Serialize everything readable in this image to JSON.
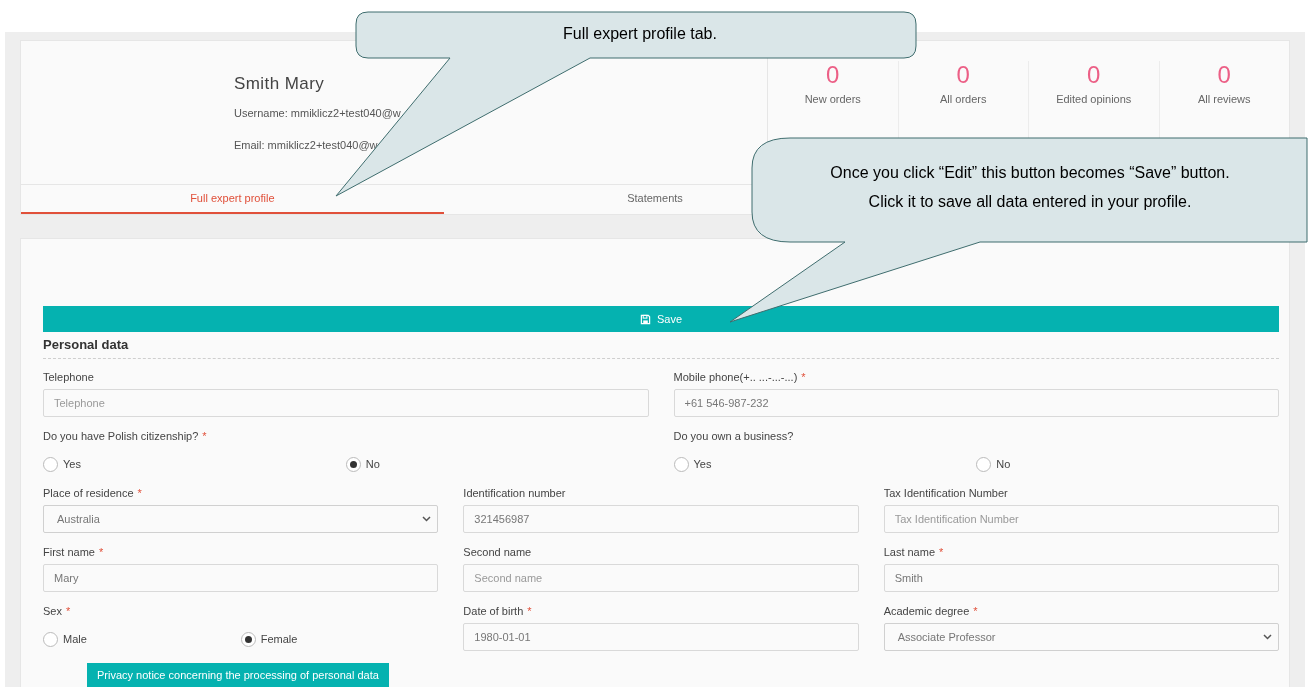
{
  "profile": {
    "name": "Smith Mary",
    "username": "Username: mmiklicz2+test040@w",
    "email": "Email: mmiklicz2+test040@w"
  },
  "stats": [
    {
      "value": "0",
      "label": "New orders"
    },
    {
      "value": "0",
      "label": "All orders"
    },
    {
      "value": "0",
      "label": "Edited opinions"
    },
    {
      "value": "0",
      "label": "All reviews"
    }
  ],
  "tabs": [
    {
      "label": "Full expert profile",
      "selected": true
    },
    {
      "label": "Statements",
      "selected": false
    }
  ],
  "form": {
    "save_button": "Save",
    "section_title": "Personal data",
    "rows": [
      [
        {
          "kind": "text",
          "label": "Telephone",
          "placeholder": "Telephone"
        },
        {
          "kind": "text",
          "label": "Mobile phone(+.. ...-...-...)",
          "required_mark": "*",
          "value": "+61 546-987-232"
        }
      ],
      [
        {
          "kind": "radio",
          "label": "Do you have Polish citizenship?",
          "required_mark": "*",
          "options": [
            {
              "label": "Yes",
              "selected": false
            },
            {
              "label": "No",
              "selected": true
            }
          ]
        },
        {
          "kind": "radio",
          "label": "Do you own a business?",
          "options": [
            {
              "label": "Yes",
              "selected": false
            },
            {
              "label": "No",
              "selected": false
            }
          ]
        }
      ],
      [
        {
          "kind": "select",
          "label": "Place of residence",
          "required_mark": "*",
          "value": "Australia"
        },
        {
          "kind": "text",
          "label": "Identification number",
          "value": "321456987"
        },
        {
          "kind": "text",
          "label": "Tax Identification Number",
          "placeholder": "Tax Identification Number"
        }
      ],
      [
        {
          "kind": "text",
          "label": "First name",
          "required_mark": "*",
          "value": "Mary"
        },
        {
          "kind": "text",
          "label": "Second name",
          "placeholder": "Second name"
        },
        {
          "kind": "text",
          "label": "Last name",
          "required_mark": "*",
          "value": "Smith"
        }
      ],
      [
        {
          "kind": "radio",
          "label": "Sex",
          "required_mark": "*",
          "options": [
            {
              "label": "Male",
              "selected": false
            },
            {
              "label": "Female",
              "selected": true
            }
          ]
        },
        {
          "kind": "text",
          "label": "Date of birth",
          "required_mark": "*",
          "value": "1980-01-01"
        },
        {
          "kind": "select",
          "label": "Academic degree",
          "required_mark": "*",
          "value": "Associate Professor"
        }
      ]
    ],
    "privacy_button": "Privacy notice concerning the processing of personal data"
  },
  "callouts": [
    {
      "lines": [
        "Full expert profile tab."
      ]
    },
    {
      "lines": [
        "Once you click “Edit” this button becomes “Save” button.",
        "Click it to save all data entered in your profile."
      ]
    }
  ]
}
